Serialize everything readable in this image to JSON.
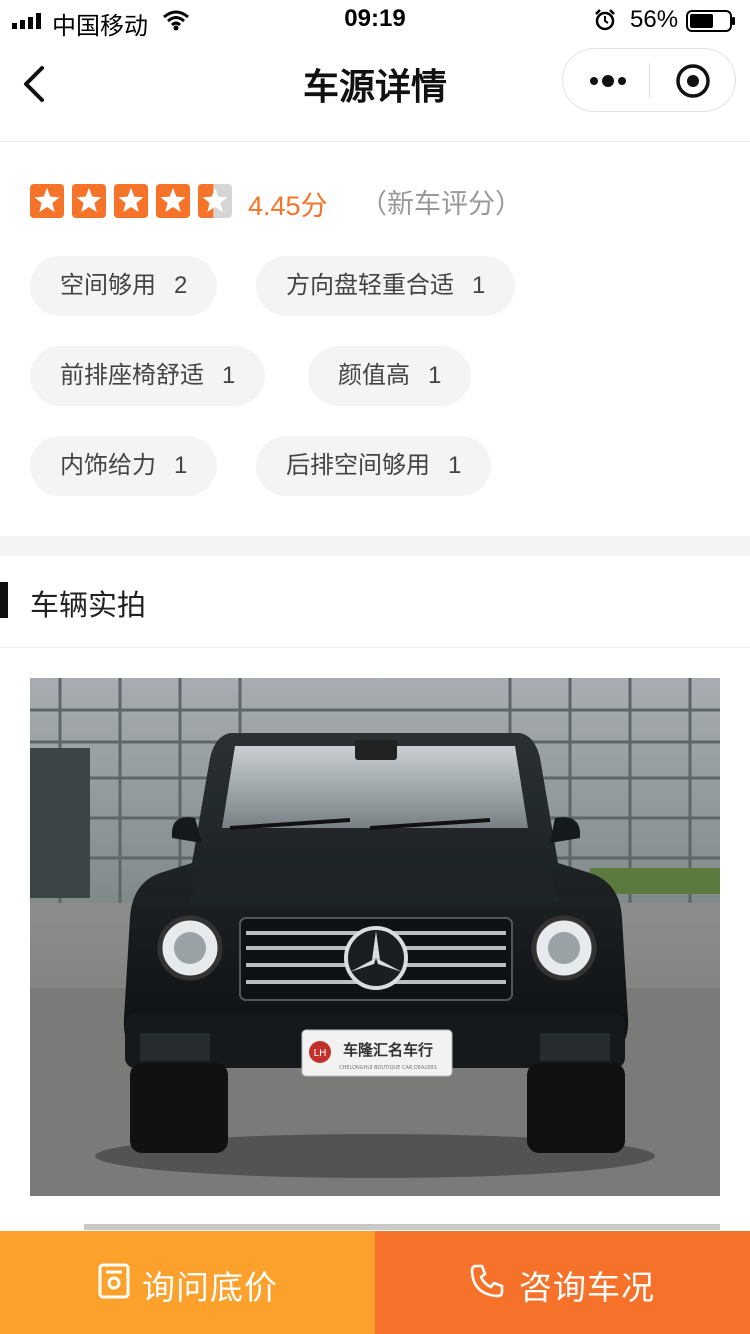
{
  "status_bar": {
    "carrier": "中国移动",
    "time": "09:19",
    "battery": "56%"
  },
  "nav": {
    "title": "车源详情"
  },
  "rating": {
    "score_text": "4.45分",
    "note": "（新车评分）",
    "stars_value": 4.45,
    "stars_max": 5
  },
  "tags": [
    {
      "label": "空间够用",
      "count": "2"
    },
    {
      "label": "方向盘轻重合适",
      "count": "1"
    },
    {
      "label": "前排座椅舒适",
      "count": "1"
    },
    {
      "label": "颜值高",
      "count": "1"
    },
    {
      "label": "内饰给力",
      "count": "1"
    },
    {
      "label": "后排空间够用",
      "count": "1"
    }
  ],
  "photos": {
    "section_title": "车辆实拍",
    "plate_text": "车隆汇名车行",
    "plate_subtext": "CHELONGHUI BOUTIQUE CAR DEALERS",
    "plate_logo": "LH"
  },
  "actions": {
    "inquire_label": "询问底价",
    "consult_label": "咨询车况"
  },
  "colors": {
    "accent_orange": "#f5742a",
    "inquire_bg": "#fba12c",
    "consult_bg": "#f6722b",
    "tag_bg": "#f4f4f4"
  }
}
